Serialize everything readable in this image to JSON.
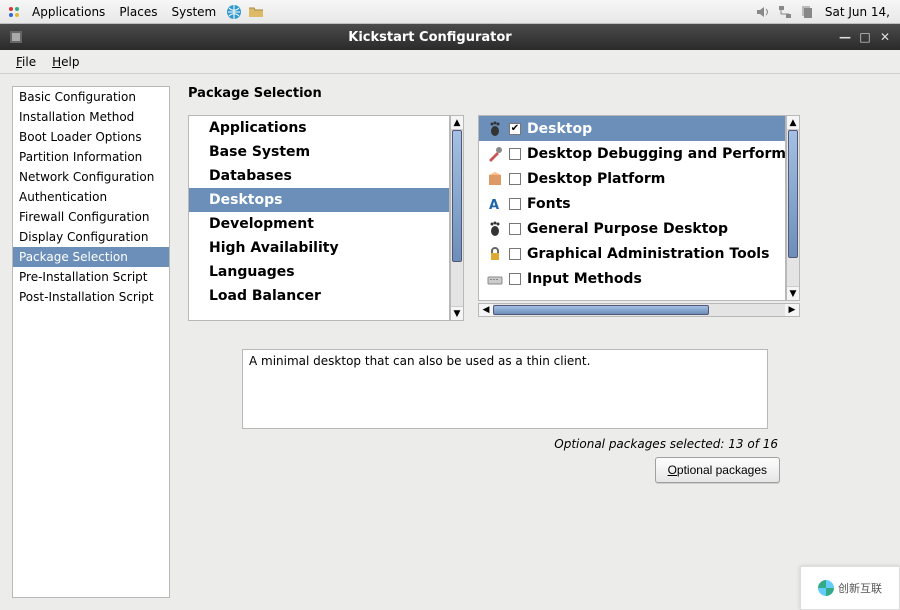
{
  "panel": {
    "apps": "Applications",
    "places": "Places",
    "system": "System",
    "clock": "Sat Jun 14,"
  },
  "window": {
    "title": "Kickstart Configurator"
  },
  "menu": {
    "file": "File",
    "file_ul": "F",
    "file_rest": "ile",
    "help": "Help",
    "help_ul": "H",
    "help_rest": "elp"
  },
  "sidebar": {
    "items": [
      {
        "label": "Basic Configuration"
      },
      {
        "label": "Installation Method"
      },
      {
        "label": "Boot Loader Options"
      },
      {
        "label": "Partition Information"
      },
      {
        "label": "Network Configuration"
      },
      {
        "label": "Authentication"
      },
      {
        "label": "Firewall Configuration"
      },
      {
        "label": "Display Configuration"
      },
      {
        "label": "Package Selection"
      },
      {
        "label": "Pre-Installation Script"
      },
      {
        "label": "Post-Installation Script"
      }
    ],
    "selected_index": 8
  },
  "content": {
    "title": "Package Selection",
    "categories": [
      {
        "label": "Applications"
      },
      {
        "label": "Base System"
      },
      {
        "label": "Databases"
      },
      {
        "label": "Desktops"
      },
      {
        "label": "Development"
      },
      {
        "label": "High Availability"
      },
      {
        "label": "Languages"
      },
      {
        "label": "Load Balancer"
      }
    ],
    "categories_selected_index": 3,
    "packages": [
      {
        "label": "Desktop",
        "checked": true
      },
      {
        "label": "Desktop Debugging and Performa",
        "checked": false
      },
      {
        "label": "Desktop Platform",
        "checked": false
      },
      {
        "label": "Fonts",
        "checked": false
      },
      {
        "label": "General Purpose Desktop",
        "checked": false
      },
      {
        "label": "Graphical Administration Tools",
        "checked": false
      },
      {
        "label": "Input Methods",
        "checked": false
      }
    ],
    "packages_selected_index": 0,
    "description": "A minimal desktop that can also be used as a thin client.",
    "optional_count_text": "Optional packages selected: 13 of 16",
    "optional_button_ul": "O",
    "optional_button_rest": "ptional packages"
  },
  "watermark": "创新互联"
}
